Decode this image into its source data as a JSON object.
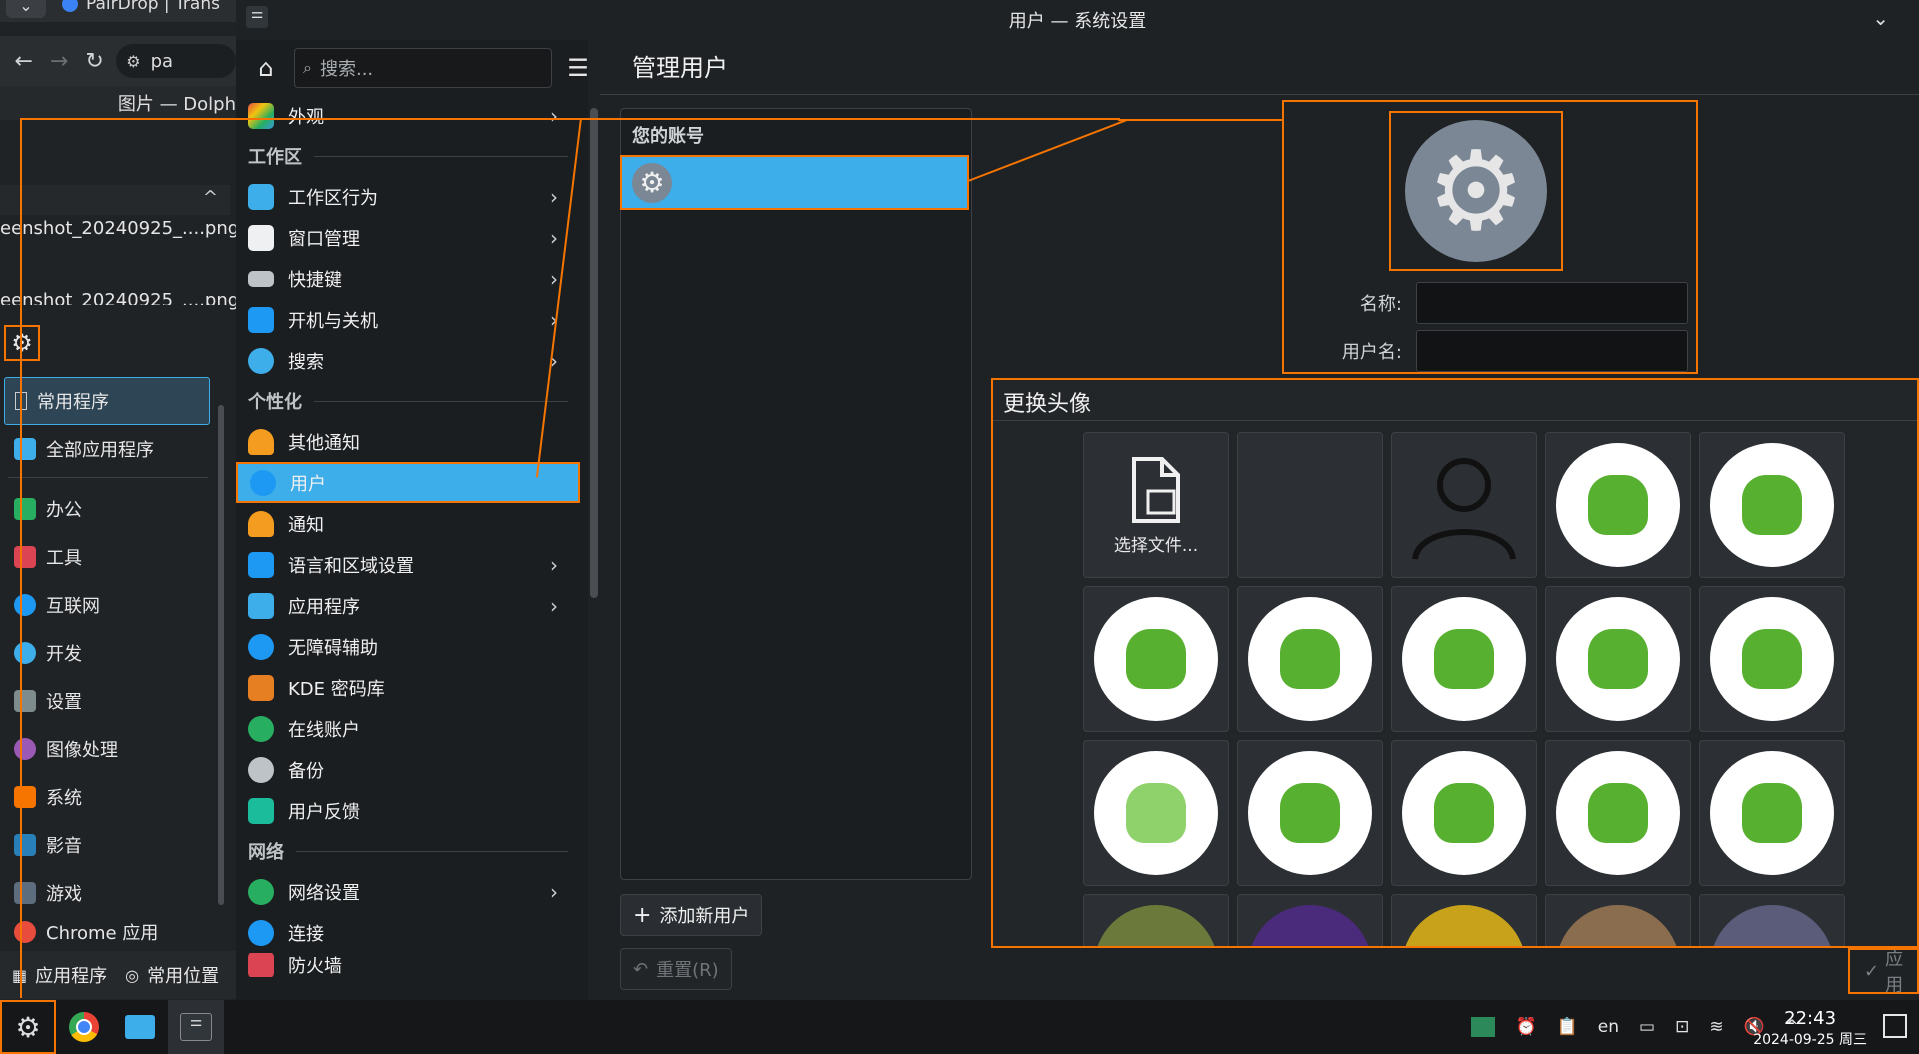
{
  "browser": {
    "tab_title": "PairDrop | Trans",
    "address_prefix": "pa",
    "dolphin_title": "图片 — Dolph"
  },
  "dolphin_files": [
    "eenshot_20240925_....png",
    "eenshot_20240925_....png"
  ],
  "launcher": {
    "favorites_label": "常用程序",
    "all_apps_label": "全部应用程序",
    "categories": [
      "办公",
      "工具",
      "互联网",
      "开发",
      "设置",
      "图像处理",
      "系统",
      "影音",
      "游戏",
      "Chrome 应用"
    ],
    "bottom_apps_label": "应用程序",
    "bottom_places_label": "常用位置"
  },
  "window": {
    "title": "用户 — 系统设置"
  },
  "sidebar": {
    "search_placeholder": "搜索...",
    "top_item": "外观",
    "sections": [
      {
        "heading": "工作区",
        "items": [
          "工作区行为",
          "窗口管理",
          "快捷键",
          "开机与关机",
          "搜索"
        ]
      },
      {
        "heading": "个性化",
        "items": [
          "其他通知",
          "用户",
          "通知",
          "语言和区域设置",
          "应用程序",
          "无障碍辅助",
          "KDE 密码库",
          "在线账户",
          "备份",
          "用户反馈"
        ]
      },
      {
        "heading": "网络",
        "items": [
          "网络设置",
          "连接",
          "防火墙"
        ]
      }
    ]
  },
  "main": {
    "page_title": "管理用户",
    "your_account_heading": "您的账号",
    "add_user_label": "添加新用户",
    "reset_label": "重置(R)",
    "name_label": "名称:",
    "username_label": "用户名:",
    "name_value": "",
    "username_value": "",
    "apply_label": "应用"
  },
  "avatar_dialog": {
    "title": "更换头像",
    "choose_file_label": "选择文件..."
  },
  "taskbar": {
    "time": "22:43",
    "date": "2024-09-25 周三",
    "keyboard_layout": "en"
  },
  "colors": {
    "accent": "#3daee9",
    "annotation": "#f67400"
  }
}
